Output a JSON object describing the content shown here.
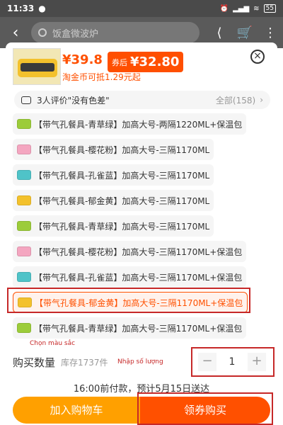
{
  "status_bar": {
    "time": "11:33",
    "battery": "55"
  },
  "header": {
    "search_placeholder": "饭盒微波炉"
  },
  "product": {
    "price": "¥39.8",
    "coupon_label": "券后",
    "coupon_price": "¥32.80",
    "tao_coin": "淘金币可抵1.29元起"
  },
  "review": {
    "text": "3人评价\"没有色差\"",
    "all": "全部(158)"
  },
  "options": [
    {
      "label": "【带气孔餐具-青草绿】加高大号-两隔1220ML+保温包",
      "color": "#9ccc3a"
    },
    {
      "label": "【带气孔餐具-樱花粉】加高大号-三隔1170ML",
      "color": "#f4a6c0"
    },
    {
      "label": "【带气孔餐具-孔雀蓝】加高大号-三隔1170ML",
      "color": "#4fc3c8"
    },
    {
      "label": "【带气孔餐具-郁金黄】加高大号-三隔1170ML",
      "color": "#f3c12c"
    },
    {
      "label": "【带气孔餐具-青草绿】加高大号-三隔1170ML",
      "color": "#9ccc3a"
    },
    {
      "label": "【带气孔餐具-樱花粉】加高大号-三隔1170ML+保温包",
      "color": "#f4a6c0"
    },
    {
      "label": "【带气孔餐具-孔雀蓝】加高大号-三隔1170ML+保温包",
      "color": "#4fc3c8"
    },
    {
      "label": "【带气孔餐具-郁金黄】加高大号-三隔1170ML+保温包",
      "color": "#f3c12c",
      "selected": true
    },
    {
      "label": "【带气孔餐具-青草绿】加高大号-三隔1170ML+保温包",
      "color": "#9ccc3a"
    }
  ],
  "annotations": {
    "choose_color": "Chọn màu sắc",
    "enter_qty": "Nhập số lượng"
  },
  "quantity": {
    "title": "购买数量",
    "stock": "库存1737件",
    "value": "1",
    "minus": "−",
    "plus": "+"
  },
  "delivery": "16:00前付款，预计5月15日送达",
  "buttons": {
    "cart": "加入购物车",
    "buy": "领券购买"
  }
}
